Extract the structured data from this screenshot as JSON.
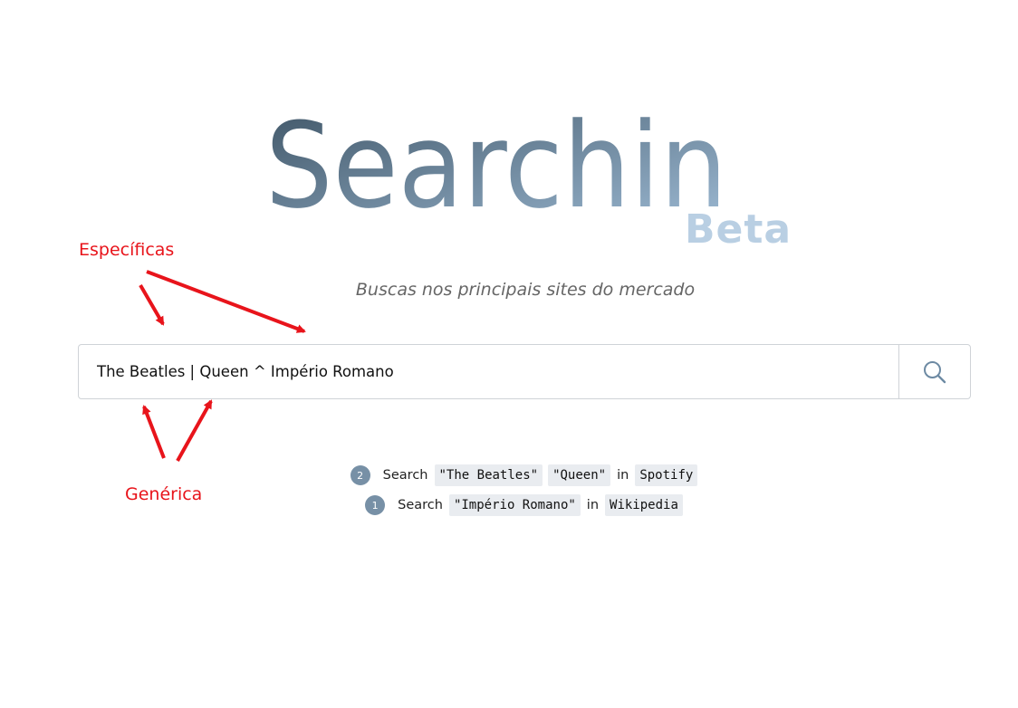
{
  "logo": {
    "title": "Searchin",
    "badge": "Beta",
    "gradient_start": "#3e5465",
    "gradient_end": "#9fbcd6"
  },
  "tagline": "Buscas nos principais sites do mercado",
  "search": {
    "value": "The Beatles | Queen ^ Império Romano",
    "button_icon": "search-icon"
  },
  "hints": [
    {
      "count": "2",
      "prefix": "Search",
      "terms": [
        "\"The Beatles\"",
        "\"Queen\""
      ],
      "connector": "in",
      "site": "Spotify"
    },
    {
      "count": "1",
      "prefix": "Search",
      "terms": [
        "\"Império Romano\""
      ],
      "connector": "in",
      "site": "Wikipedia"
    }
  ],
  "annotations": {
    "specific": "Específicas",
    "generic": "Genérica",
    "color": "#e8141b"
  }
}
